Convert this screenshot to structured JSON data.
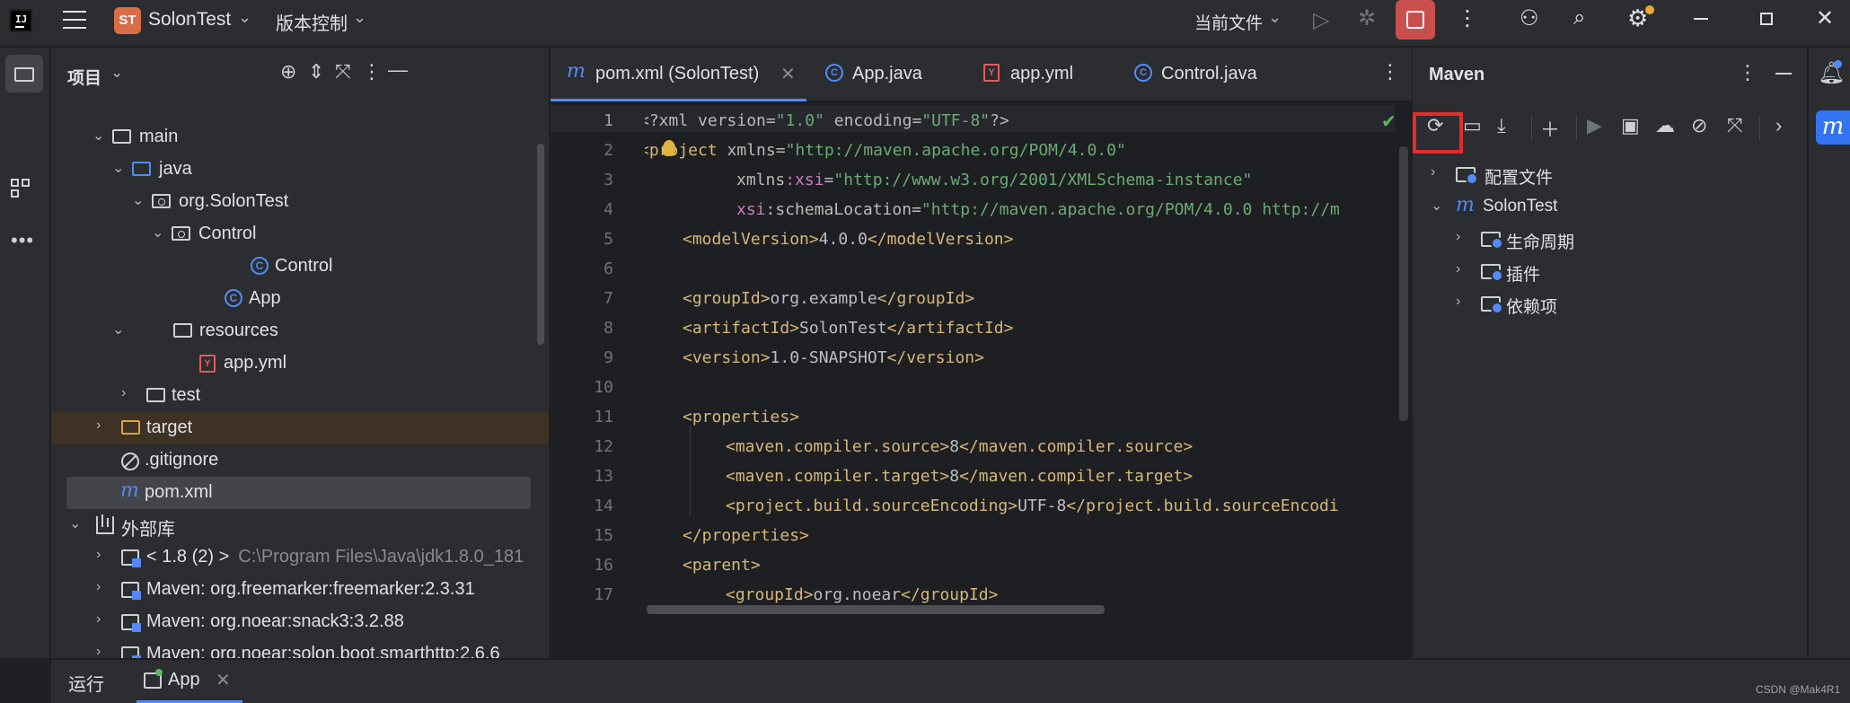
{
  "titlebar": {
    "logo_text": "IJ",
    "project_badge": "ST",
    "project_name": "SolonTest",
    "vcs": "版本控制",
    "current_file": "当前文件",
    "colors": {
      "stop_button": "#c94f4f",
      "settings_dot": "#f0a732"
    }
  },
  "project_panel": {
    "title": "项目",
    "tree": [
      {
        "label": "main",
        "icon": "folder-icon"
      },
      {
        "label": "java",
        "icon": "source-folder-icon"
      },
      {
        "label": "org.SolonTest",
        "icon": "package-icon"
      },
      {
        "label": "Control",
        "icon": "package-icon"
      },
      {
        "label": "Control",
        "icon": "class-icon"
      },
      {
        "label": "App",
        "icon": "class-icon"
      },
      {
        "label": "resources",
        "icon": "resources-folder-icon"
      },
      {
        "label": "app.yml",
        "icon": "yaml-icon"
      },
      {
        "label": "test",
        "icon": "folder-icon"
      },
      {
        "label": "target",
        "icon": "excluded-folder-icon"
      },
      {
        "label": ".gitignore",
        "icon": "ignore-file-icon"
      },
      {
        "label": "pom.xml",
        "icon": "maven-icon"
      },
      {
        "label": "外部库",
        "icon": "library-icon"
      },
      {
        "label": "< 1.8 (2) >",
        "hint": "C:\\Program Files\\Java\\jdk1.8.0_181",
        "icon": "jdk-icon"
      },
      {
        "label": "Maven: org.freemarker:freemarker:2.3.31",
        "icon": "jar-icon"
      },
      {
        "label": "Maven: org.noear:snack3:3.2.88",
        "icon": "jar-icon"
      },
      {
        "label": "Maven: org.noear:solon.boot.smarthttp:2.6.6",
        "icon": "jar-icon"
      }
    ]
  },
  "editor": {
    "tabs": [
      {
        "label": "pom.xml (SolonTest)",
        "icon": "maven-icon",
        "active": true
      },
      {
        "label": "App.java",
        "icon": "class-icon"
      },
      {
        "label": "app.yml",
        "icon": "yaml-icon"
      },
      {
        "label": "Control.java",
        "icon": "class-icon"
      }
    ],
    "line_numbers": [
      "1",
      "2",
      "3",
      "4",
      "5",
      "6",
      "7",
      "8",
      "9",
      "10",
      "11",
      "12",
      "13",
      "14",
      "15",
      "16",
      "17"
    ],
    "code": {
      "l1": [
        "<?xml version=",
        "\"1.0\"",
        " encoding=",
        "\"UTF-8\"",
        "?>"
      ],
      "l2": [
        "<project",
        " xmlns=",
        "\"http://maven.apache.org/POM/4.0.0\""
      ],
      "l3": [
        "xmlns",
        ":xsi",
        "=",
        "\"http://www.w3.org/2001/XMLSchema-instance\""
      ],
      "l4": [
        "xsi",
        ":schemaLocation=",
        "\"http://maven.apache.org/POM/4.0.0 http://m"
      ],
      "l5": [
        "<modelVersion>",
        "4.0.0",
        "</modelVersion>"
      ],
      "l7": [
        "<groupId>",
        "org.example",
        "</groupId>"
      ],
      "l8": [
        "<artifactId>",
        "SolonTest",
        "</artifactId>"
      ],
      "l9": [
        "<version>",
        "1.0-SNAPSHOT",
        "</version>"
      ],
      "l11": [
        "<properties>"
      ],
      "l12": [
        "<maven.compiler.source>",
        "8",
        "</maven.compiler.source>"
      ],
      "l13": [
        "<maven.compiler.target>",
        "8",
        "</maven.compiler.target>"
      ],
      "l14": [
        "<project.build.sourceEncoding>",
        "UTF-8",
        "</project.build.sourceEncodi"
      ],
      "l15": [
        "</properties>"
      ],
      "l16": [
        "<parent>"
      ],
      "l17": [
        "<groupId>",
        "org.noear",
        "</groupId>"
      ]
    },
    "colors": {
      "tag": "#d5b778",
      "attr_value": "#6aab73",
      "namespace": "#c77dbb",
      "text": "#bcbec4"
    }
  },
  "maven_panel": {
    "title": "Maven",
    "tree": [
      {
        "label": "配置文件",
        "icon": "profiles-folder-icon"
      },
      {
        "label": "SolonTest",
        "icon": "maven-icon"
      },
      {
        "label": "生命周期",
        "icon": "lifecycle-folder-icon"
      },
      {
        "label": "插件",
        "icon": "plugins-folder-icon"
      },
      {
        "label": "依赖项",
        "icon": "dependencies-folder-icon"
      }
    ],
    "highlight_color": "#e22d2d"
  },
  "bottom_bar": {
    "run_label": "运行",
    "run_tab": "App"
  },
  "watermark": "CSDN @Mak4R1"
}
